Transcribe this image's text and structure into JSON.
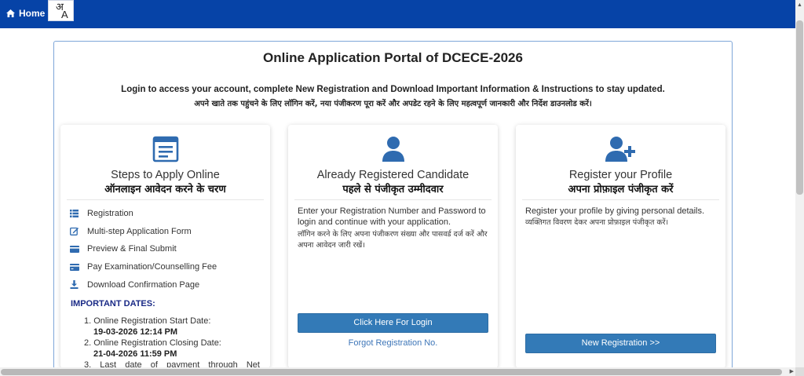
{
  "navbar": {
    "home_label": "Home",
    "lang_hi": "अ",
    "lang_en": "A"
  },
  "panel": {
    "title": "Online Application Portal of DCECE-2026",
    "intro_en": "Login to access your account, complete New Registration and Download Important Information & Instructions to stay updated.",
    "intro_hi": "अपने खाते तक पहुंचने के लिए लॉगिन करें, नया पंजीकरण पूरा करें और अपडेट रहने के लिए महत्वपूर्ण जानकारी और निर्देश डाउनलोड करें।"
  },
  "steps_card": {
    "title": "Steps to Apply Online",
    "title_hi": "ऑनलाइन आवेदन करने के चरण",
    "steps": [
      {
        "label": "Registration",
        "icon": "list-icon"
      },
      {
        "label": "Multi-step Application Form",
        "icon": "edit-icon"
      },
      {
        "label": "Preview & Final Submit",
        "icon": "card-icon"
      },
      {
        "label": "Pay Examination/Counselling Fee",
        "icon": "credit-card-icon"
      },
      {
        "label": "Download Confirmation Page",
        "icon": "download-icon"
      }
    ],
    "dates_title": "IMPORTANT DATES:",
    "dates": [
      {
        "label": "1. Online Registration Start Date:",
        "value": "19-03-2026 12:14 PM"
      },
      {
        "label": "2. Online Registration Closing Date:",
        "value": "21-04-2026 11:59 PM"
      },
      {
        "label": "3. Last date of payment through Net"
      }
    ]
  },
  "login_card": {
    "title": "Already Registered Candidate",
    "title_hi": "पहले से पंजीकृत उम्मीदवार",
    "desc": "Enter your Registration Number and Password to login and continue with your application.",
    "desc_hi": "लॉगिन करने के लिए अपना पंजीकरण संख्या और पासवर्ड दर्ज करें और अपना आवेदन जारी रखें।",
    "login_button": "Click Here For Login",
    "forgot_link": "Forgot Registration No."
  },
  "register_card": {
    "title": "Register your Profile",
    "title_hi": "अपना प्रोफ़ाइल पंजीकृत करें",
    "desc": "Register your profile by giving personal details.",
    "desc_hi": "व्यक्तिगत विवरण देकर अपना प्रोफ़ाइल पंजीकृत करें।",
    "register_button": "New Registration >>"
  },
  "colors": {
    "navbar": "#0643a7",
    "accent": "#337ab7",
    "dates_title": "#1a2a86"
  }
}
